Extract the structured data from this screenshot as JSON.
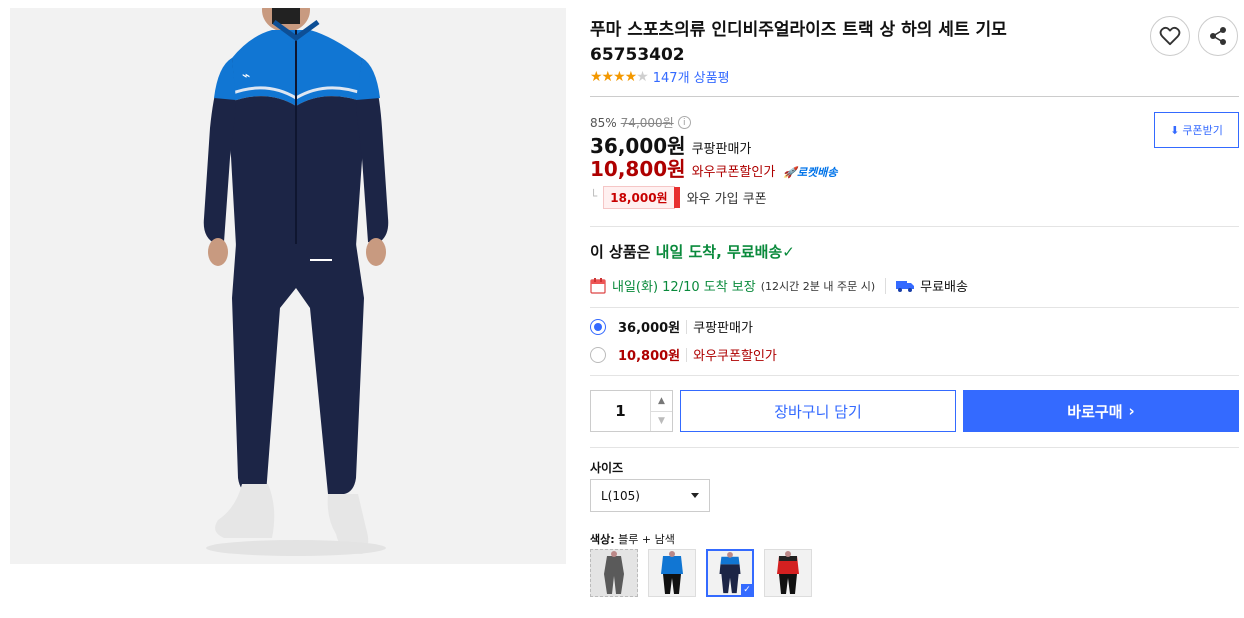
{
  "product": {
    "title_line1": "푸마 스포츠의류 인디비주얼라이즈 트랙 상 하의 세트 기모",
    "title_line2": "65753402",
    "rating": 4,
    "review_link": "147개 상품평"
  },
  "pricing": {
    "discount_percent": "85%",
    "original_price": "74,000원",
    "sale_price": "36,000원",
    "sale_label": "쿠팡판매가",
    "wow_price": "10,800원",
    "wow_label": "와우쿠폰할인가",
    "rocket_badge": "로켓배송",
    "coupon_amount": "18,000원",
    "coupon_label": "와우 가입 쿠폰",
    "coupon_button": "쿠폰받기"
  },
  "delivery": {
    "headline_prefix": "이 상품은 ",
    "headline_highlight": "내일 도착, 무료배송",
    "arrival_text": "내일(화) 12/10 도착 보장",
    "order_deadline": "(12시간 2분 내 주문 시)",
    "free_shipping": "무료배송"
  },
  "options": [
    {
      "price": "36,000원",
      "label": "쿠팡판매가",
      "selected": true
    },
    {
      "price": "10,800원",
      "label": "와우쿠폰할인가",
      "selected": false
    }
  ],
  "purchase": {
    "quantity": "1",
    "cart_button": "장바구니 담기",
    "buy_button": "바로구매"
  },
  "size": {
    "label": "사이즈",
    "selected": "L(105)"
  },
  "color": {
    "label_prefix": "색상:",
    "selected": "블루 + 남색",
    "swatches": [
      "grey",
      "blue-black",
      "blue-navy",
      "red-black"
    ],
    "selected_index": 2
  },
  "colors": {
    "accent": "#346aff",
    "price_red": "#ae0000",
    "delivery_green": "#0a8a3c"
  }
}
